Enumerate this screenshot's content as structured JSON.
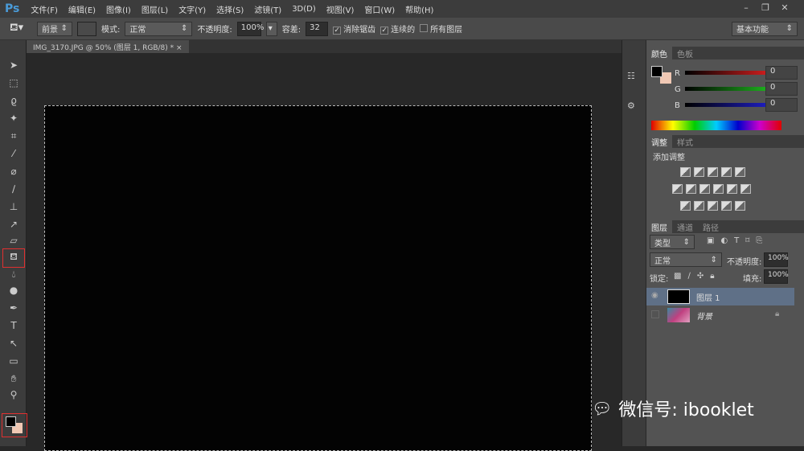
{
  "app": {
    "logo": "Ps"
  },
  "menu": [
    "文件(F)",
    "编辑(E)",
    "图像(I)",
    "图层(L)",
    "文字(Y)",
    "选择(S)",
    "滤镜(T)",
    "3D(D)",
    "视图(V)",
    "窗口(W)",
    "帮助(H)"
  ],
  "window_controls": {
    "minimize": "–",
    "restore": "❐",
    "close": "✕"
  },
  "options": {
    "fill_source": "前景",
    "mode_label": "模式:",
    "mode_value": "正常",
    "opacity_label": "不透明度:",
    "opacity_value": "100%",
    "tolerance_label": "容差:",
    "tolerance_value": "32",
    "antialias": "消除锯齿",
    "contiguous": "连续的",
    "all_layers": "所有图层",
    "workspace": "基本功能"
  },
  "document_tab": {
    "title": "IMG_3170.JPG @ 50% (图层 1, RGB/8) *",
    "close": "×"
  },
  "color_panel": {
    "tabs": [
      "颜色",
      "色板"
    ],
    "r_label": "R",
    "g_label": "G",
    "b_label": "B",
    "r": "0",
    "g": "0",
    "b": "0"
  },
  "adjust_panel": {
    "tabs": [
      "调整",
      "样式"
    ],
    "title": "添加调整"
  },
  "layers_panel": {
    "tabs": [
      "图层",
      "通道",
      "路径"
    ],
    "filter": "类型",
    "blend": "正常",
    "opacity_label": "不透明度:",
    "opacity": "100%",
    "lock_label": "锁定:",
    "fill_label": "填充:",
    "fill": "100%",
    "layers": [
      {
        "name": "图层 1"
      },
      {
        "name": "背景"
      }
    ]
  },
  "watermark": {
    "text": "微信号: ibooklet"
  },
  "colors": {
    "foreground": "#000000",
    "background": "#f0c8b4"
  }
}
